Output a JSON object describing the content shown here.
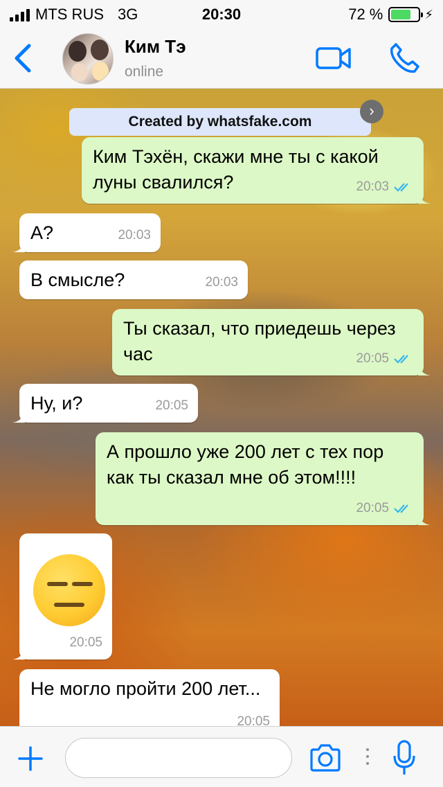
{
  "status_bar": {
    "carrier": "MTS RUS",
    "network": "3G",
    "time": "20:30",
    "battery_percent": "72 %",
    "battery_level": 0.72
  },
  "header": {
    "contact_name": "Ким Тэ",
    "contact_status": "online",
    "accent_color": "#007aff"
  },
  "watermark": {
    "text": "Created by whatsfake.com",
    "close_glyph": "›"
  },
  "messages": [
    {
      "direction": "out",
      "text": "Ким Тэхён, скажи мне ты с какой луны свалился?",
      "time": "20:03",
      "status": "read"
    },
    {
      "direction": "in",
      "text": "А?",
      "time": "20:03"
    },
    {
      "direction": "in",
      "text": "В смысле?",
      "time": "20:03"
    },
    {
      "direction": "out",
      "text": "Ты сказал, что приедешь через час",
      "time": "20:05",
      "status": "read"
    },
    {
      "direction": "in",
      "text": "Ну, и?",
      "time": "20:05"
    },
    {
      "direction": "out",
      "text": "А прошло уже 200 лет с тех пор как ты сказал мне об этом!!!!",
      "time": "20:05",
      "status": "read"
    },
    {
      "direction": "in",
      "type": "emoji",
      "emoji": "expressionless-face",
      "time": "20:05"
    },
    {
      "direction": "in",
      "text": "Не могло пройти 200 лет...",
      "time": "20:05"
    }
  ],
  "composer": {
    "placeholder": ""
  },
  "icons": {
    "back": "chevron-left-icon",
    "video": "video-camera-icon",
    "call": "phone-icon",
    "plus": "plus-icon",
    "camera": "camera-icon",
    "mic": "microphone-icon"
  }
}
